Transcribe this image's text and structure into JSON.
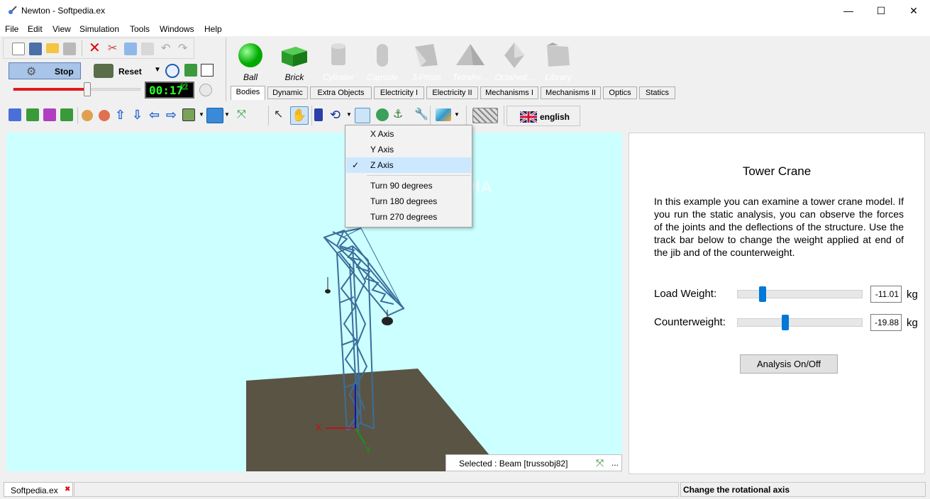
{
  "window": {
    "title": "Newton - Softpedia.ex",
    "min": "—",
    "max": "☐",
    "close": "✕"
  },
  "menu": [
    "File",
    "Edit",
    "View",
    "Simulation",
    "Tools",
    "Windows",
    "Help"
  ],
  "simulation": {
    "stop_label": "Stop",
    "reset_label": "Reset",
    "timer": "00:17",
    "timer_ms": "09",
    "speed_fraction": 0.58
  },
  "bodies": [
    {
      "label": "Ball",
      "enabled": true
    },
    {
      "label": "Brick",
      "enabled": true
    },
    {
      "label": "Cylinder",
      "enabled": false
    },
    {
      "label": "Capsule",
      "enabled": false
    },
    {
      "label": "3-Prism",
      "enabled": false
    },
    {
      "label": "Tetrahe...",
      "enabled": false
    },
    {
      "label": "Octahed...",
      "enabled": false
    },
    {
      "label": "Library",
      "enabled": false
    }
  ],
  "tabs": [
    "Bodies",
    "Dynamic",
    "Extra Objects",
    "Electricity I",
    "Electricity II",
    "Mechanisms I",
    "Mechanisms II",
    "Optics",
    "Statics"
  ],
  "active_tab": "Bodies",
  "language": "english",
  "axis_menu": {
    "items": [
      "X Axis",
      "Y Axis",
      "Z Axis"
    ],
    "checked": "Z Axis",
    "turns": [
      "Turn 90 degrees",
      "Turn 180 degrees",
      "Turn 270 degrees"
    ]
  },
  "viewport": {
    "selected": "Selected : Beam [trussobj82]",
    "axis_x": "X",
    "axis_y": "Y",
    "watermark": "SOFTPEDIA",
    "more": "..."
  },
  "panel": {
    "title": "Tower Crane",
    "description": "In this example you can examine a tower crane model. If you run the static analysis, you can observe the forces of the joints and the deflections of the structure. Use the track bar below to change the weight applied at end of the jib and of the counterweight.",
    "load_label": "Load Weight:",
    "load_value": "-11.01",
    "load_fraction": 0.2,
    "counter_label": "Counterweight:",
    "counter_value": "-19.88",
    "counter_fraction": 0.38,
    "unit": "kg",
    "analysis_button": "Analysis On/Off"
  },
  "status": {
    "doc_tab": "Softpedia.ex",
    "close": "✖",
    "hint": "Change the rotational axis"
  },
  "colors": {
    "viewport_bg": "#ccffff",
    "ground": "#5a5445",
    "truss": "#3a6e9a",
    "accent": "#0078d7"
  }
}
